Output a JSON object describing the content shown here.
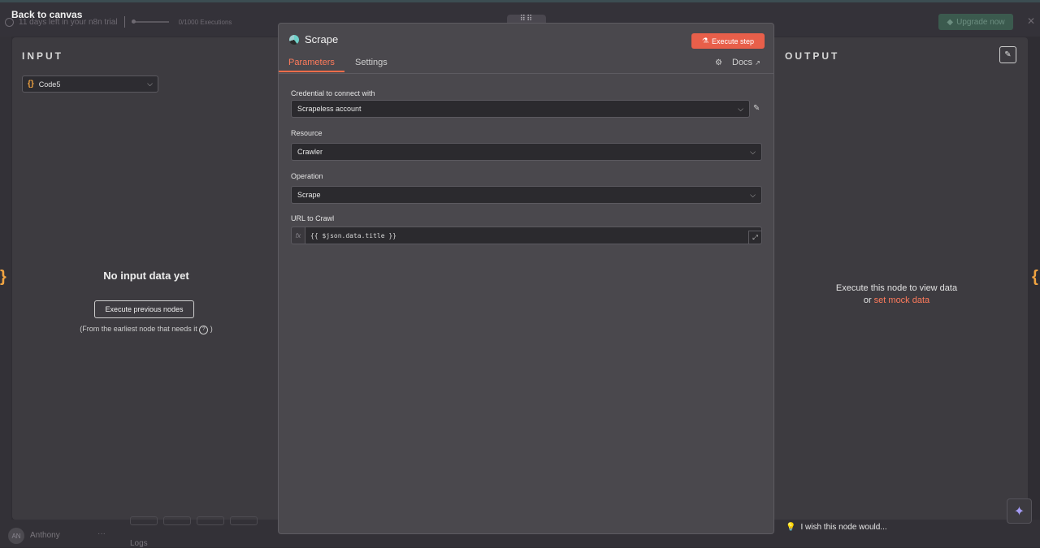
{
  "background": {
    "trial_text": "11 days left in your n8n trial",
    "executions": "0/1000 Executions",
    "upgrade_label": "Upgrade now",
    "user_initials": "AN",
    "user_name": "Anthony",
    "logs_label": "Logs"
  },
  "nav": {
    "back_label": "Back to canvas"
  },
  "input_panel": {
    "title": "INPUT",
    "node_select_value": "Code5",
    "empty_title": "No input data yet",
    "execute_previous_label": "Execute previous nodes",
    "hint": "(From the earliest node that needs it ",
    "hint_end": ")"
  },
  "node": {
    "title": "Scrape",
    "execute_step_label": "Execute step",
    "tabs": [
      "Parameters",
      "Settings"
    ],
    "docs_label": "Docs",
    "params": {
      "credential_label": "Credential to connect with",
      "credential_value": "Scrapeless account",
      "resource_label": "Resource",
      "resource_value": "Crawler",
      "operation_label": "Operation",
      "operation_value": "Scrape",
      "url_label": "URL to Crawl",
      "url_value": "{{ $json.data.title }}",
      "fx_label": "fx"
    }
  },
  "output_panel": {
    "title": "OUTPUT",
    "message_line1": "Execute this node to view data",
    "message_or": "or ",
    "mock_link": "set mock data"
  },
  "footer": {
    "wish_label": "I wish this node would..."
  },
  "colors": {
    "accent": "#ff6d4a",
    "execute_button": "#e85f4a",
    "code_node": "#f0a341"
  }
}
